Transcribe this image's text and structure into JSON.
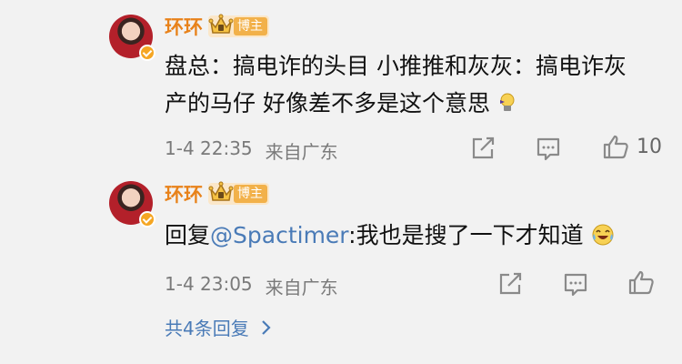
{
  "comments": [
    {
      "username": "环环",
      "badge": "博主",
      "content_text": "盘总：搞电诈的头目 小推推和灰灰：搞电诈灰产的马仔 好像差不多是这个意思",
      "emoji": "lightbulb-emoji",
      "time": "1-4 22:35",
      "location": "来自广东",
      "like_count": "10"
    },
    {
      "username": "环环",
      "badge": "博主",
      "reply_prefix": "回复",
      "mention": "@Spactimer",
      "content_text": ":我也是搜了一下才知道",
      "emoji": "laughing-crying-emoji",
      "time": "1-4 23:05",
      "location": "来自广东",
      "like_count": ""
    }
  ],
  "more_replies_label": "共4条回复",
  "colors": {
    "username": "#e8821a",
    "link": "#4a7bb7",
    "meta": "#7a7a7a",
    "background": "#f2f2f2"
  },
  "icons": [
    "share-icon",
    "comment-icon",
    "like-icon",
    "chevron-right-icon",
    "crown-icon",
    "verified-icon"
  ]
}
